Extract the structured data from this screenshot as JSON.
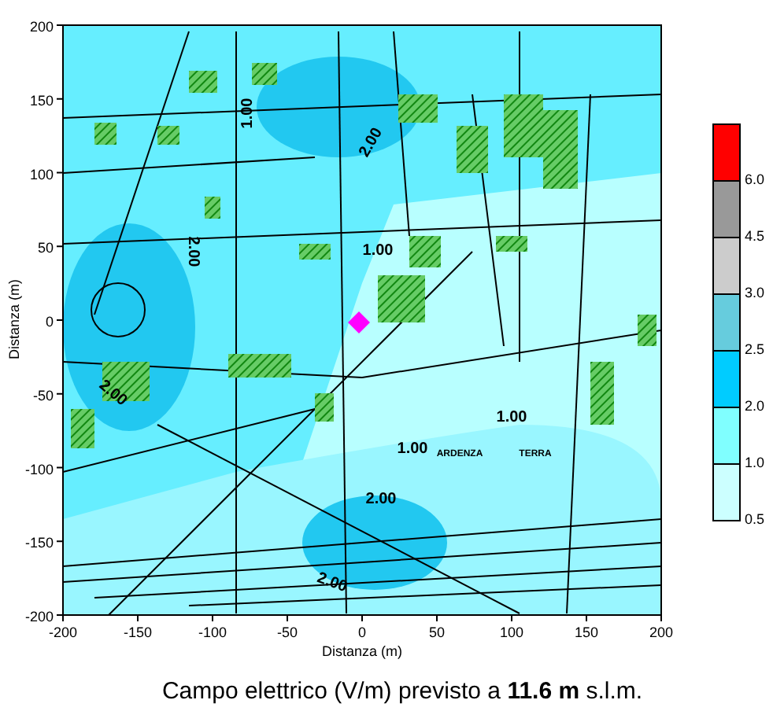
{
  "chart": {
    "xlabel": "Distanza (m)",
    "ylabel": "Distanza (m)",
    "xticks": [
      "-200",
      "-150",
      "-100",
      "-50",
      "0",
      "50",
      "100",
      "150",
      "200"
    ],
    "yticks": [
      "200",
      "150",
      "100",
      "50",
      "0",
      "-50",
      "-100",
      "-150",
      "-200"
    ],
    "map_labels": [
      {
        "text": "1.00",
        "kind": "contour"
      },
      {
        "text": "2.00",
        "kind": "contour"
      },
      {
        "text": "1.00",
        "kind": "contour"
      },
      {
        "text": "2.00",
        "kind": "contour"
      },
      {
        "text": "1.00",
        "kind": "contour"
      },
      {
        "text": "1.00",
        "kind": "contour"
      },
      {
        "text": "2.00",
        "kind": "contour"
      },
      {
        "text": "2.00",
        "kind": "contour"
      },
      {
        "text": "ARDENZA",
        "kind": "place"
      },
      {
        "text": "TERRA",
        "kind": "place"
      },
      {
        "text": "2.00",
        "kind": "contour"
      }
    ]
  },
  "legend": {
    "bands": [
      {
        "color": "#ff0000",
        "label": "6.0"
      },
      {
        "color": "#999999",
        "label": "4.5"
      },
      {
        "color": "#cccccc",
        "label": "3.0"
      },
      {
        "color": "#66ccdd",
        "label": "2.5"
      },
      {
        "color": "#00ccff",
        "label": "2.0"
      },
      {
        "color": "#80ffff",
        "label": "1.0"
      },
      {
        "color": "#ccffff",
        "label": "0.5"
      }
    ]
  },
  "caption": "Campo elettrico (V/m) previsto a **11.6 m** s.l.m."
}
